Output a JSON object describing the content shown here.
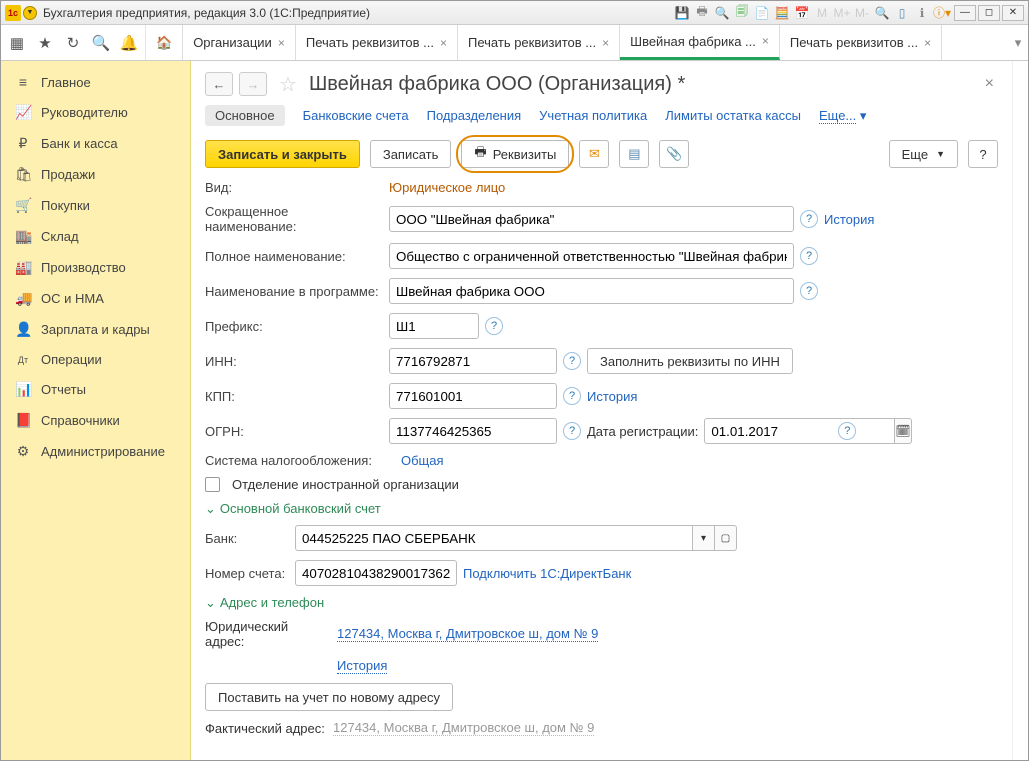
{
  "titlebar": {
    "title": "Бухгалтерия предприятия, редакция 3.0  (1С:Предприятие)"
  },
  "doc_tabs": [
    {
      "label": "Организации"
    },
    {
      "label": "Печать реквизитов ..."
    },
    {
      "label": "Печать реквизитов ..."
    },
    {
      "label": "Швейная фабрика ...",
      "active": true
    },
    {
      "label": "Печать реквизитов ..."
    }
  ],
  "sidebar": [
    {
      "icon": "≡",
      "label": "Главное"
    },
    {
      "icon": "📈",
      "label": "Руководителю"
    },
    {
      "icon": "₽",
      "label": "Банк и касса"
    },
    {
      "icon": "🛍",
      "label": "Продажи"
    },
    {
      "icon": "🛒",
      "label": "Покупки"
    },
    {
      "icon": "🏬",
      "label": "Склад"
    },
    {
      "icon": "🏭",
      "label": "Производство"
    },
    {
      "icon": "🚚",
      "label": "ОС и НМА"
    },
    {
      "icon": "👤",
      "label": "Зарплата и кадры"
    },
    {
      "icon": "Дт",
      "label": "Операции"
    },
    {
      "icon": "📊",
      "label": "Отчеты"
    },
    {
      "icon": "📕",
      "label": "Справочники"
    },
    {
      "icon": "⚙",
      "label": "Администрирование"
    }
  ],
  "page": {
    "title": "Швейная фабрика ООО (Организация) *",
    "subtabs": {
      "main": "Основное",
      "bank": "Банковские счета",
      "dept": "Подразделения",
      "policy": "Учетная политика",
      "limits": "Лимиты остатка кассы",
      "more": "Еще..."
    },
    "actions": {
      "save_close": "Записать и закрыть",
      "save": "Записать",
      "requisites": "Реквизиты",
      "more": "Еще",
      "help": "?"
    },
    "form": {
      "kind_label": "Вид:",
      "kind_value": "Юридическое лицо",
      "short_label": "Сокращенное наименование:",
      "short_value": "ООО \"Швейная фабрика\"",
      "history": "История",
      "full_label": "Полное наименование:",
      "full_value": "Общество с ограниченной ответственностью \"Швейная фабрика\"",
      "prog_label": "Наименование в программе:",
      "prog_value": "Швейная фабрика ООО",
      "prefix_label": "Префикс:",
      "prefix_value": "Ш1",
      "inn_label": "ИНН:",
      "inn_value": "7716792871",
      "fill_inn_btn": "Заполнить реквизиты по ИНН",
      "kpp_label": "КПП:",
      "kpp_value": "771601001",
      "kpp_history": "История",
      "ogrn_label": "ОГРН:",
      "ogrn_value": "1137746425365",
      "regdate_label": "Дата регистрации:",
      "regdate_value": "01.01.2017",
      "tax_label": "Система налогообложения:",
      "tax_value": "Общая",
      "foreign_cb": "Отделение иностранной организации",
      "section_bank": "Основной банковский счет",
      "bank_label": "Банк:",
      "bank_value": "044525225 ПАО СБЕРБАНК",
      "acct_label": "Номер счета:",
      "acct_value": "40702810438290017362",
      "direct_bank": "Подключить 1С:ДиректБанк",
      "section_addr": "Адрес и телефон",
      "legal_addr_label": "Юридический адрес:",
      "legal_addr_value": "127434, Москва г, Дмитровское ш, дом № 9",
      "addr_history": "История",
      "new_addr_btn": "Поставить на учет по новому адресу",
      "fact_addr_label": "Фактический адрес:",
      "fact_addr_value": "127434, Москва г, Дмитровское ш, дом № 9"
    }
  }
}
